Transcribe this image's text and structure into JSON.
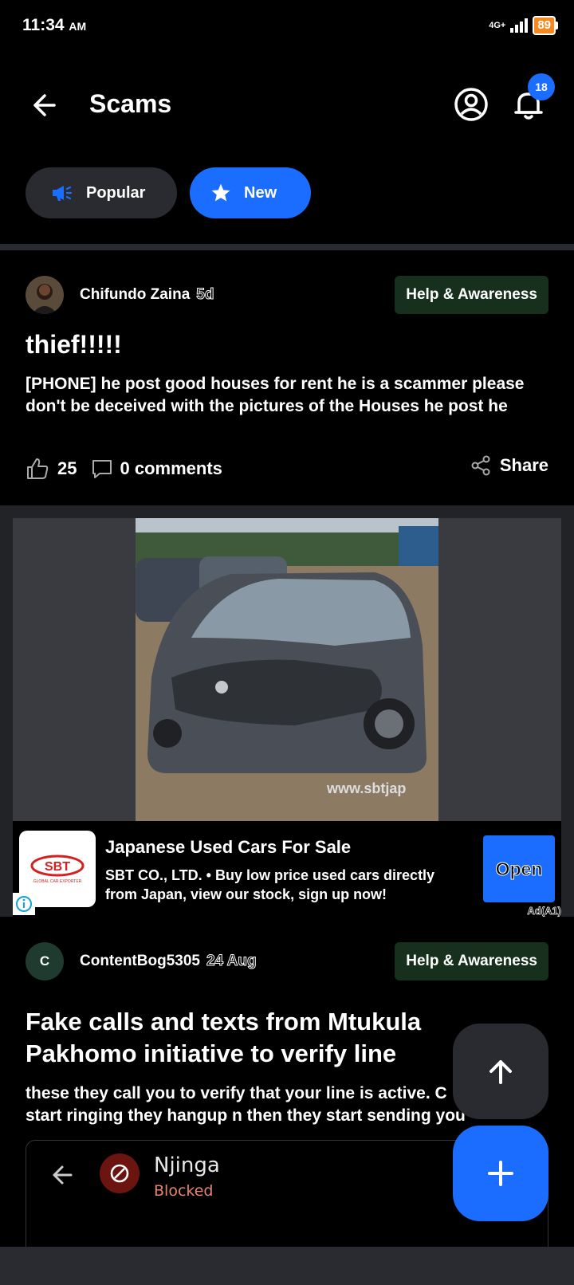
{
  "status_bar": {
    "time": "11:34",
    "ampm": "AM",
    "network": "4G+",
    "battery": "89"
  },
  "header": {
    "title": "Scams",
    "notification_count": "18"
  },
  "tabs": [
    {
      "label": "Popular",
      "selected": false
    },
    {
      "label": "New",
      "selected": true
    }
  ],
  "posts": [
    {
      "author": "Chifundo Zaina",
      "age": "5d",
      "category": "Help & Awareness",
      "title": "thief!!!!!",
      "body": "[PHONE] he post good houses for rent he is a scammer please don't be deceived with the pictures of the Houses he post he",
      "likes": "25",
      "comments_count": "0",
      "comments_label": "comments",
      "share_label": "Share"
    },
    {
      "author": "ContentBog5305",
      "avatar_letter": "C",
      "age": "24 Aug",
      "category": "Help & Awareness",
      "title": "Fake calls and texts from Mtukula Pakhomo initiative to verify line",
      "body": "these they call you to verify that your line is active. C start ringing they hangup n then they start sending you",
      "embed": {
        "name": "Njinga",
        "status": "Blocked"
      }
    }
  ],
  "ad": {
    "watermark": "www.sbtjap",
    "logo_text": "SBT",
    "logo_subtext": "GLOBAL CAR EXPORTER",
    "title": "Japanese Used Cars For Sale",
    "description": "SBT CO., LTD. • Buy low price used cars directly from Japan, view our stock, sign up now!",
    "cta": "Open",
    "label": "Ad(A1)"
  },
  "colors": {
    "accent": "#1a6dff",
    "category_bg": "#17301e",
    "surface": "#2a2b30",
    "battery": "#f5891f",
    "blocked": "#e7846f"
  }
}
